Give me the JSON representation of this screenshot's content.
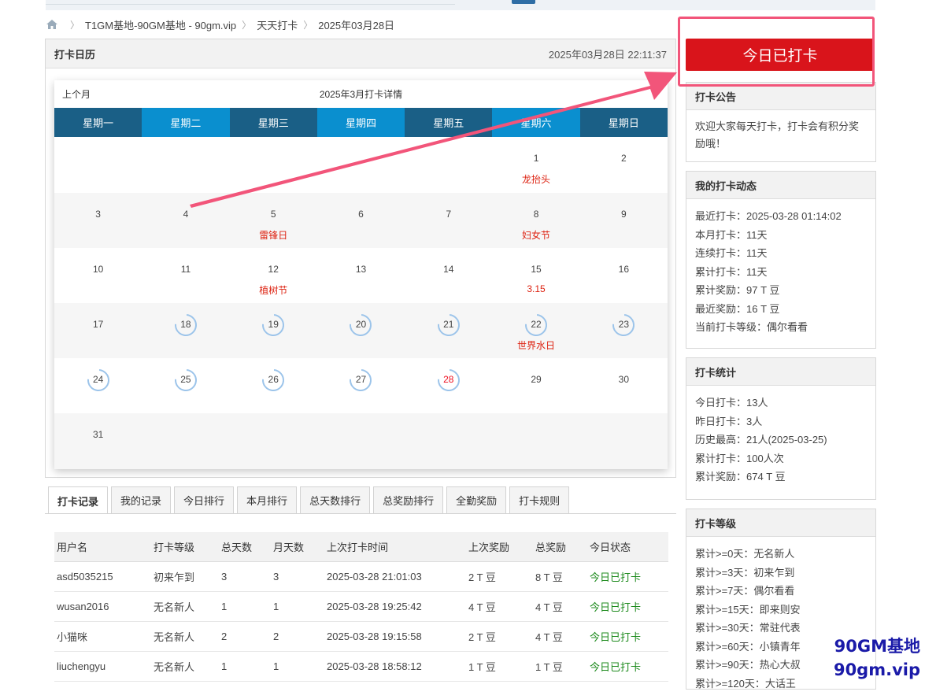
{
  "breadcrumb": [
    "T1GM基地-90GM基地 - 90gm.vip",
    "天天打卡",
    "2025年03月28日"
  ],
  "calendar": {
    "heading": "打卡日历",
    "datetime": "2025年03月28日 22:11:37",
    "prev_month": "上个月",
    "title": "2025年3月打卡详情",
    "weekdays": [
      "星期一",
      "星期二",
      "星期三",
      "星期四",
      "星期五",
      "星期六",
      "星期日"
    ],
    "days": [
      {
        "n": "",
        "f": ""
      },
      {
        "n": "",
        "f": ""
      },
      {
        "n": "",
        "f": ""
      },
      {
        "n": "",
        "f": ""
      },
      {
        "n": "",
        "f": ""
      },
      {
        "n": "1",
        "f": "龙抬头"
      },
      {
        "n": "2",
        "f": ""
      },
      {
        "n": "3",
        "f": ""
      },
      {
        "n": "4",
        "f": ""
      },
      {
        "n": "5",
        "f": "雷锋日"
      },
      {
        "n": "6",
        "f": ""
      },
      {
        "n": "7",
        "f": ""
      },
      {
        "n": "8",
        "f": "妇女节"
      },
      {
        "n": "9",
        "f": ""
      },
      {
        "n": "10",
        "f": ""
      },
      {
        "n": "11",
        "f": ""
      },
      {
        "n": "12",
        "f": "植树节"
      },
      {
        "n": "13",
        "f": ""
      },
      {
        "n": "14",
        "f": ""
      },
      {
        "n": "15",
        "f": "3.15"
      },
      {
        "n": "16",
        "f": ""
      },
      {
        "n": "17",
        "f": ""
      },
      {
        "n": "18",
        "f": "",
        "c": true
      },
      {
        "n": "19",
        "f": "",
        "c": true
      },
      {
        "n": "20",
        "f": "",
        "c": true
      },
      {
        "n": "21",
        "f": "",
        "c": true
      },
      {
        "n": "22",
        "f": "世界水日",
        "c": true
      },
      {
        "n": "23",
        "f": "",
        "c": true
      },
      {
        "n": "24",
        "f": "",
        "c": true
      },
      {
        "n": "25",
        "f": "",
        "c": true
      },
      {
        "n": "26",
        "f": "",
        "c": true
      },
      {
        "n": "27",
        "f": "",
        "c": true
      },
      {
        "n": "28",
        "f": "",
        "c": true,
        "today": true
      },
      {
        "n": "29",
        "f": ""
      },
      {
        "n": "30",
        "f": ""
      },
      {
        "n": "31",
        "f": ""
      },
      {
        "n": "",
        "f": ""
      },
      {
        "n": "",
        "f": ""
      },
      {
        "n": "",
        "f": ""
      },
      {
        "n": "",
        "f": ""
      },
      {
        "n": "",
        "f": ""
      },
      {
        "n": "",
        "f": ""
      }
    ]
  },
  "tabs": [
    "打卡记录",
    "我的记录",
    "今日排行",
    "本月排行",
    "总天数排行",
    "总奖励排行",
    "全勤奖励",
    "打卡规则"
  ],
  "records": {
    "headers": [
      "用户名",
      "打卡等级",
      "总天数",
      "月天数",
      "上次打卡时间",
      "上次奖励",
      "总奖励",
      "今日状态"
    ],
    "rows": [
      [
        "asd5035215",
        "初来乍到",
        "3",
        "3",
        "2025-03-28 21:01:03",
        "2 T 豆",
        "8 T 豆",
        "今日已打卡"
      ],
      [
        "wusan2016",
        "无名新人",
        "1",
        "1",
        "2025-03-28 19:25:42",
        "4 T 豆",
        "4 T 豆",
        "今日已打卡"
      ],
      [
        "小猫咪",
        "无名新人",
        "2",
        "2",
        "2025-03-28 19:15:58",
        "2 T 豆",
        "4 T 豆",
        "今日已打卡"
      ],
      [
        "liuchengyu",
        "无名新人",
        "1",
        "1",
        "2025-03-28 18:58:12",
        "1 T 豆",
        "1 T 豆",
        "今日已打卡"
      ]
    ]
  },
  "checkin_button": "今日已打卡",
  "notice": {
    "title": "打卡公告",
    "text": "欢迎大家每天打卡，打卡会有积分奖励哦！"
  },
  "my_status": {
    "title": "我的打卡动态",
    "lines": [
      "最近打卡：2025-03-28 01:14:02",
      "本月打卡：11天",
      "连续打卡：11天",
      "累计打卡：11天",
      "累计奖励：97 T 豆",
      "最近奖励：16 T 豆",
      "当前打卡等级：偶尔看看"
    ]
  },
  "stats": {
    "title": "打卡统计",
    "lines": [
      "今日打卡：13人",
      "昨日打卡：3人",
      "历史最高：21人(2025-03-25)",
      "累计打卡：100人次",
      "累计奖励：674 T 豆"
    ]
  },
  "levels": {
    "title": "打卡等级",
    "lines": [
      "累计>=0天：无名新人",
      "累计>=3天：初来乍到",
      "累计>=7天：偶尔看看",
      "累计>=15天：即来则安",
      "累计>=30天：常驻代表",
      "累计>=60天：小镇青年",
      "累计>=90天：热心大叔",
      "累计>=120天：大话王"
    ]
  },
  "watermark": [
    "90GM基地",
    "90gm.vip"
  ],
  "colors": {
    "checkin_button": "#d9141b",
    "weekday_dark": "#1a5f86",
    "weekday_light": "#0a8fcf",
    "festival": "#d21",
    "checked_status": "#1d8a1d",
    "highlight": "#f2557a"
  }
}
